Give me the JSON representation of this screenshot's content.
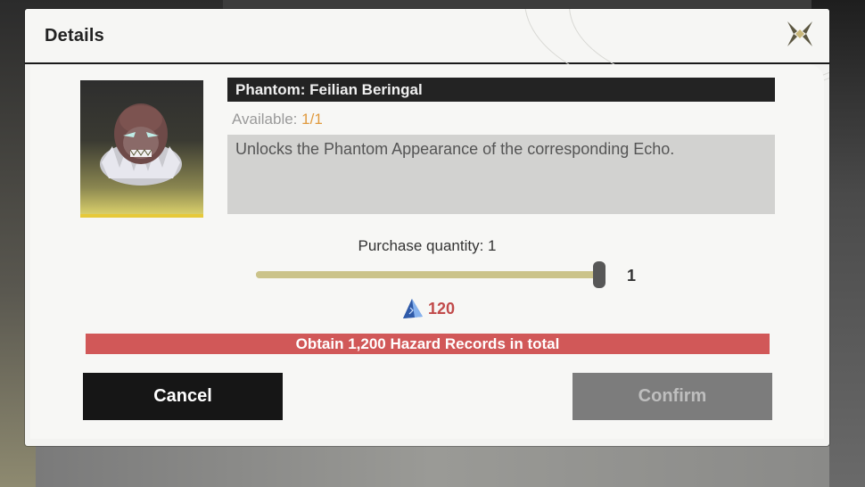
{
  "dialog": {
    "title": "Details",
    "close_icon": "close-x-icon"
  },
  "item": {
    "name": "Phantom: Feilian Beringal",
    "available_label": "Available: ",
    "available_value": "1/1",
    "description": "Unlocks the Phantom Appearance of the corresponding Echo.",
    "image_icon": "feilian-beringal-portrait"
  },
  "purchase": {
    "quantity_label": "Purchase quantity: 1",
    "quantity_value": "1",
    "slider_fraction": 1.0,
    "cost_icon": "crystal-icon",
    "cost_value": "120"
  },
  "requirement": {
    "text": "Obtain 1,200 Hazard Records in total"
  },
  "buttons": {
    "cancel_label": "Cancel",
    "confirm_label": "Confirm"
  },
  "colors": {
    "accent_yellow": "#e6c93a",
    "requirement_red": "#d15858",
    "cost_red": "#c14a4a",
    "available_orange": "#e09a3e"
  }
}
